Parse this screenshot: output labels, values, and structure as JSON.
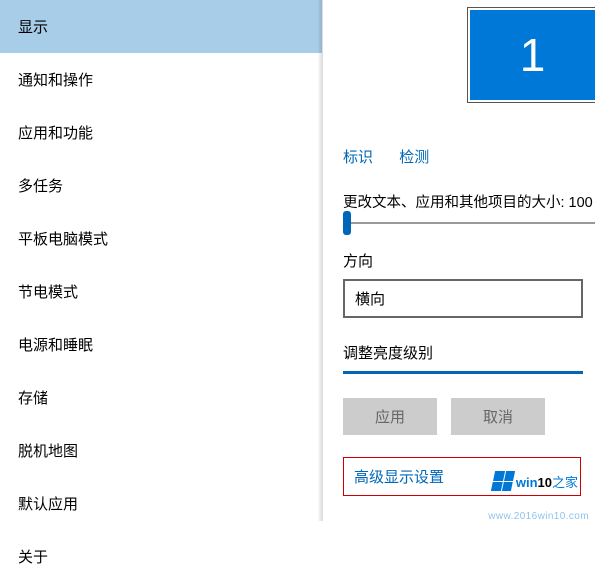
{
  "sidebar": {
    "items": [
      {
        "label": "显示",
        "selected": true
      },
      {
        "label": "通知和操作"
      },
      {
        "label": "应用和功能"
      },
      {
        "label": "多任务"
      },
      {
        "label": "平板电脑模式"
      },
      {
        "label": "节电模式"
      },
      {
        "label": "电源和睡眠"
      },
      {
        "label": "存储"
      },
      {
        "label": "脱机地图"
      },
      {
        "label": "默认应用"
      },
      {
        "label": "关于"
      }
    ]
  },
  "main": {
    "monitor_number": "1",
    "link_identify": "标识",
    "link_detect": "检测",
    "scale_label": "更改文本、应用和其他项目的大小: 100",
    "orientation_label": "方向",
    "orientation_value": "横向",
    "brightness_label": "调整亮度级别",
    "btn_apply": "应用",
    "btn_cancel": "取消",
    "advanced_link": "高级显示设置"
  },
  "watermark": {
    "brand_win": "win",
    "brand_10": "10",
    "brand_cn": "之家",
    "url": "www.2016win10.com"
  }
}
